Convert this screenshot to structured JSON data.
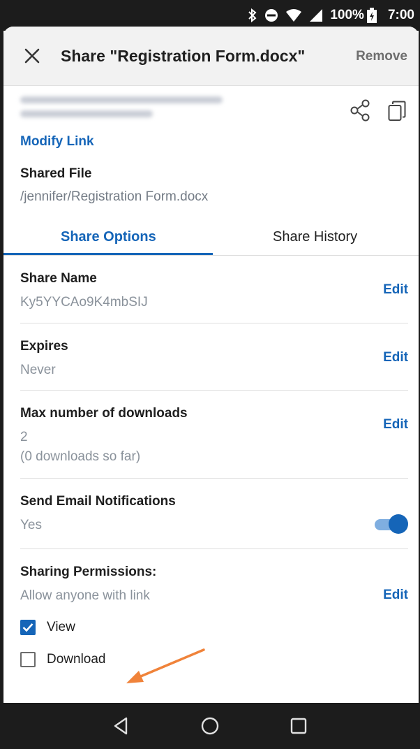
{
  "status_bar": {
    "battery": "100%",
    "time": "7:00",
    "icons": [
      "bluetooth-icon",
      "do-not-disturb-icon",
      "wifi-icon",
      "signal-icon",
      "battery-charging-icon"
    ]
  },
  "header": {
    "title": "Share \"Registration Form.docx\"",
    "remove_label": "Remove"
  },
  "link": {
    "modify_label": "Modify Link"
  },
  "shared_file": {
    "label": "Shared File",
    "path": "/jennifer/Registration Form.docx"
  },
  "tabs": [
    {
      "label": "Share Options",
      "active": true
    },
    {
      "label": "Share History",
      "active": false
    }
  ],
  "options": {
    "share_name": {
      "title": "Share Name",
      "value": "Ky5YYCAo9K4mbSIJ",
      "edit": "Edit"
    },
    "expires": {
      "title": "Expires",
      "value": "Never",
      "edit": "Edit"
    },
    "max_downloads": {
      "title": "Max number of downloads",
      "value": "2",
      "note": "(0 downloads so far)",
      "edit": "Edit"
    },
    "email_notifications": {
      "title": "Send Email Notifications",
      "value": "Yes",
      "enabled": true
    },
    "permissions": {
      "title": "Sharing Permissions:",
      "value": "Allow anyone with link",
      "edit": "Edit",
      "items": [
        {
          "label": "View",
          "checked": true
        },
        {
          "label": "Download",
          "checked": false
        }
      ]
    }
  },
  "colors": {
    "accent": "#1565b8",
    "secondary_text": "#8a929b",
    "annotation_arrow": "#f0833a"
  }
}
